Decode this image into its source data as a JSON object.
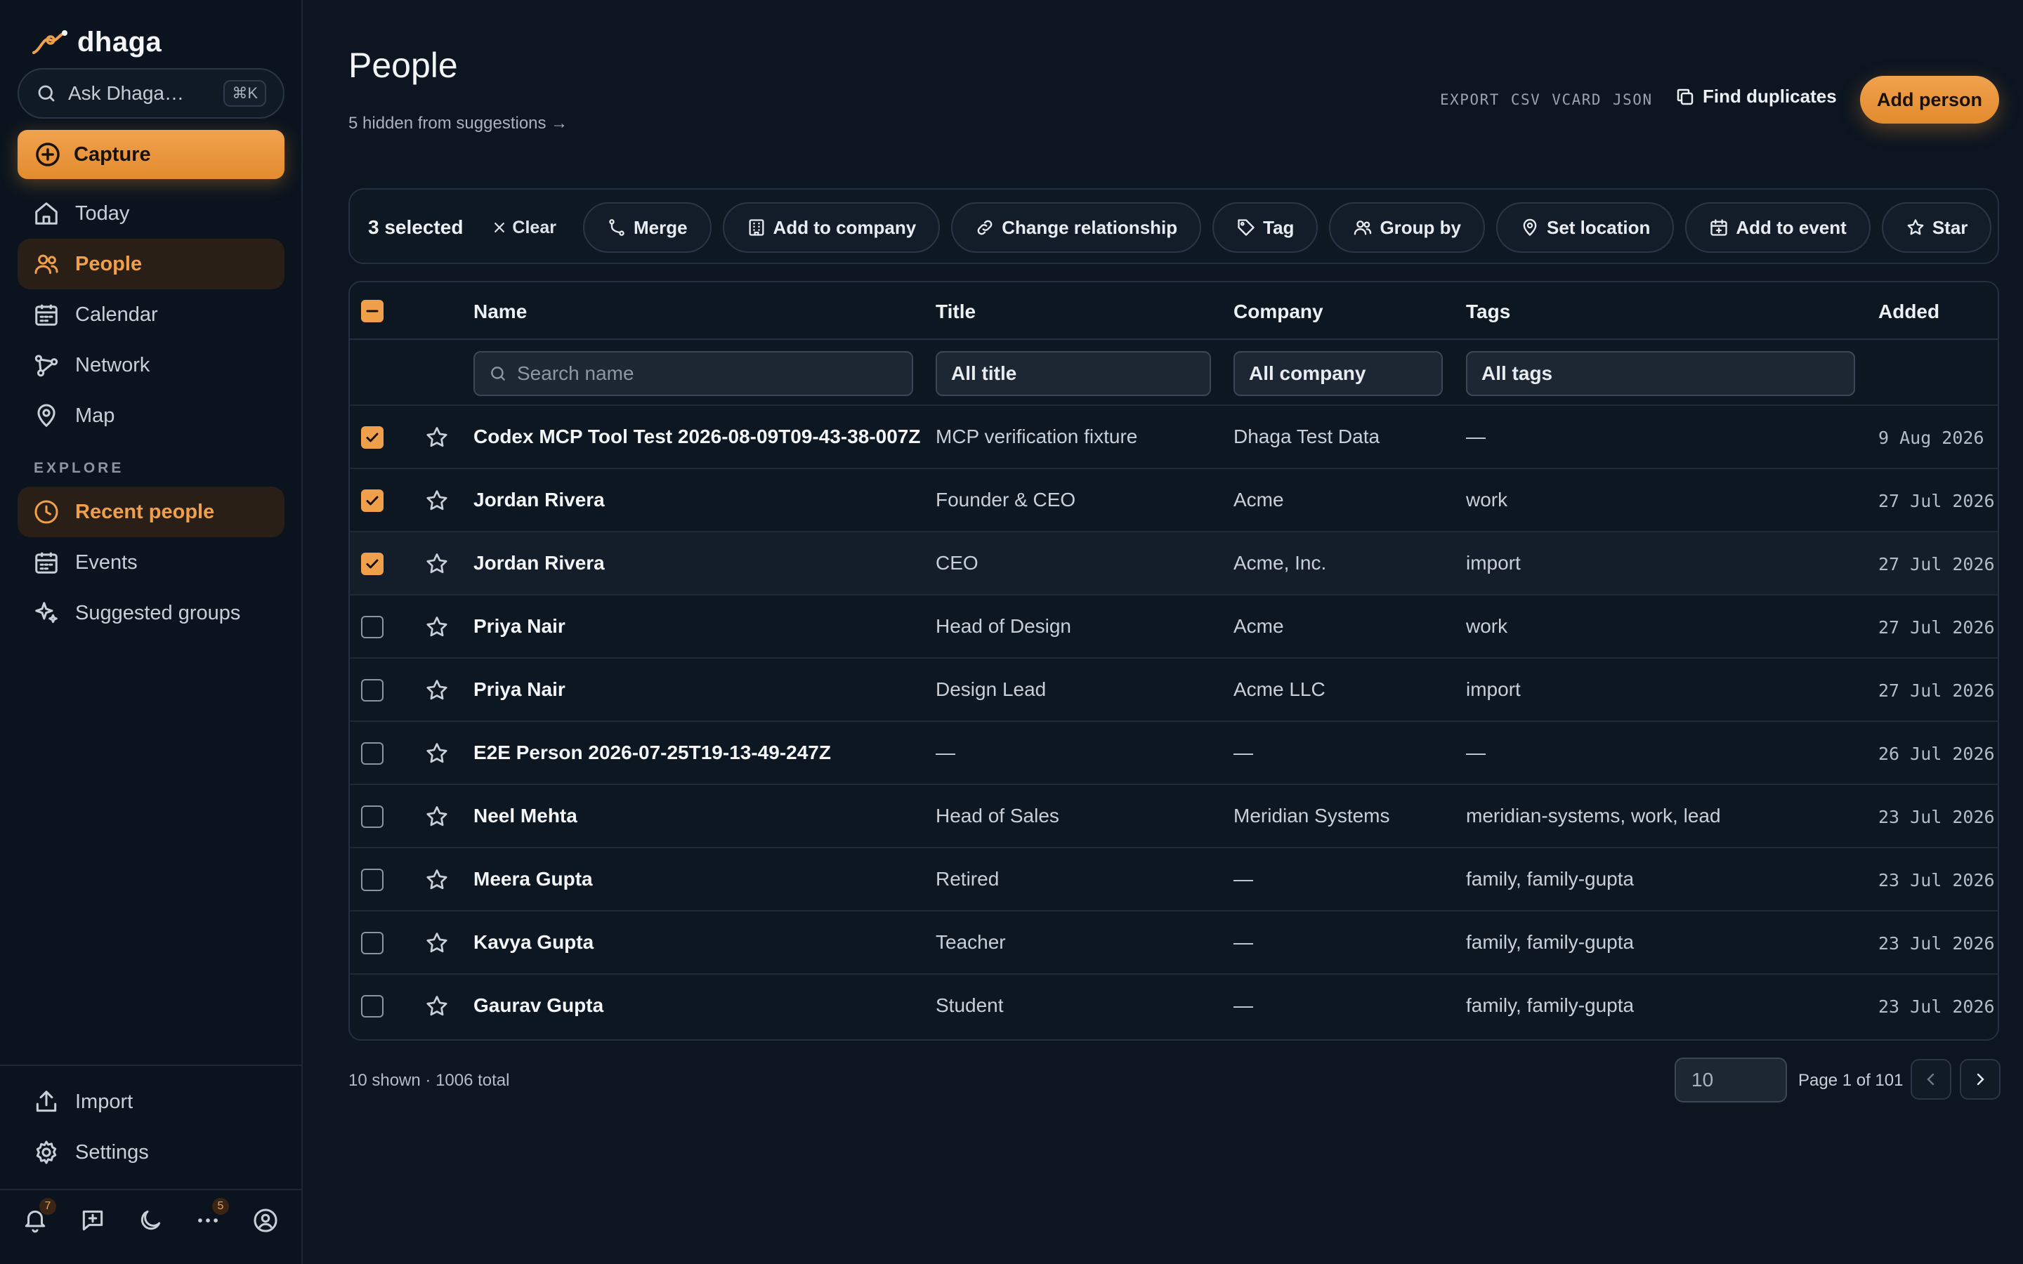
{
  "app": {
    "brand": "dhaga",
    "search_placeholder": "Ask Dhaga…",
    "search_shortcut": "⌘K",
    "capture_label": "Capture"
  },
  "sidebar": {
    "items": [
      {
        "label": "Today",
        "icon": "home-icon"
      },
      {
        "label": "People",
        "icon": "people-icon",
        "active": true
      },
      {
        "label": "Calendar",
        "icon": "calendar-icon"
      },
      {
        "label": "Network",
        "icon": "network-icon"
      },
      {
        "label": "Map",
        "icon": "map-pin-icon"
      }
    ],
    "explore_label": "EXPLORE",
    "explore_items": [
      {
        "label": "Recent people",
        "icon": "clock-icon",
        "active": true
      },
      {
        "label": "Events",
        "icon": "calendar-icon"
      },
      {
        "label": "Suggested groups",
        "icon": "sparkles-icon"
      }
    ],
    "bottom_items": [
      {
        "label": "Import",
        "icon": "upload-icon"
      },
      {
        "label": "Settings",
        "icon": "gear-icon"
      }
    ],
    "footer": {
      "notifications_badge": "7",
      "more_badge": "5"
    }
  },
  "header": {
    "title": "People",
    "hidden_link": "5 hidden from suggestions →",
    "export_label": "EXPORT",
    "export_formats": [
      "CSV",
      "VCARD",
      "JSON"
    ],
    "find_duplicates": "Find duplicates",
    "add_person": "Add person"
  },
  "actionbar": {
    "selected": "3 selected",
    "clear": "Clear",
    "actions": [
      "Merge",
      "Add to company",
      "Change relationship",
      "Tag",
      "Group by",
      "Set location",
      "Add to event",
      "Star"
    ]
  },
  "table": {
    "columns": {
      "name": "Name",
      "title": "Title",
      "company": "Company",
      "tags": "Tags",
      "added": "Added"
    },
    "filters": {
      "name_placeholder": "Search name",
      "title": "All title",
      "company": "All company",
      "tags": "All tags"
    },
    "rows": [
      {
        "selected": true,
        "name": "Codex MCP Tool Test 2026-08-09T09-43-38-007Z",
        "title": "MCP verification fixture",
        "company": "Dhaga Test Data",
        "tags": "—",
        "added": "9 Aug 2026"
      },
      {
        "selected": true,
        "name": "Jordan Rivera",
        "title": "Founder & CEO",
        "company": "Acme",
        "tags": "work",
        "added": "27 Jul 2026"
      },
      {
        "selected": true,
        "name": "Jordan Rivera",
        "title": "CEO",
        "company": "Acme, Inc.",
        "tags": "import",
        "added": "27 Jul 2026"
      },
      {
        "selected": false,
        "name": "Priya Nair",
        "title": "Head of Design",
        "company": "Acme",
        "tags": "work",
        "added": "27 Jul 2026"
      },
      {
        "selected": false,
        "name": "Priya Nair",
        "title": "Design Lead",
        "company": "Acme LLC",
        "tags": "import",
        "added": "27 Jul 2026"
      },
      {
        "selected": false,
        "name": "E2E Person 2026-07-25T19-13-49-247Z",
        "title": "—",
        "company": "—",
        "tags": "—",
        "added": "26 Jul 2026"
      },
      {
        "selected": false,
        "name": "Neel Mehta",
        "title": "Head of Sales",
        "company": "Meridian Systems",
        "tags": "meridian-systems, work, lead",
        "added": "23 Jul 2026"
      },
      {
        "selected": false,
        "name": "Meera Gupta",
        "title": "Retired",
        "company": "—",
        "tags": "family, family-gupta",
        "added": "23 Jul 2026"
      },
      {
        "selected": false,
        "name": "Kavya Gupta",
        "title": "Teacher",
        "company": "—",
        "tags": "family, family-gupta",
        "added": "23 Jul 2026"
      },
      {
        "selected": false,
        "name": "Gaurav Gupta",
        "title": "Student",
        "company": "—",
        "tags": "family, family-gupta",
        "added": "23 Jul 2026"
      }
    ]
  },
  "pagination": {
    "shown": "10 shown · 1006 total",
    "page_size": "10",
    "page_info": "Page 1 of 101"
  },
  "colors": {
    "accent": "#f0a04a",
    "background": "#0c1520",
    "sidebar_bg": "#0b141e"
  }
}
